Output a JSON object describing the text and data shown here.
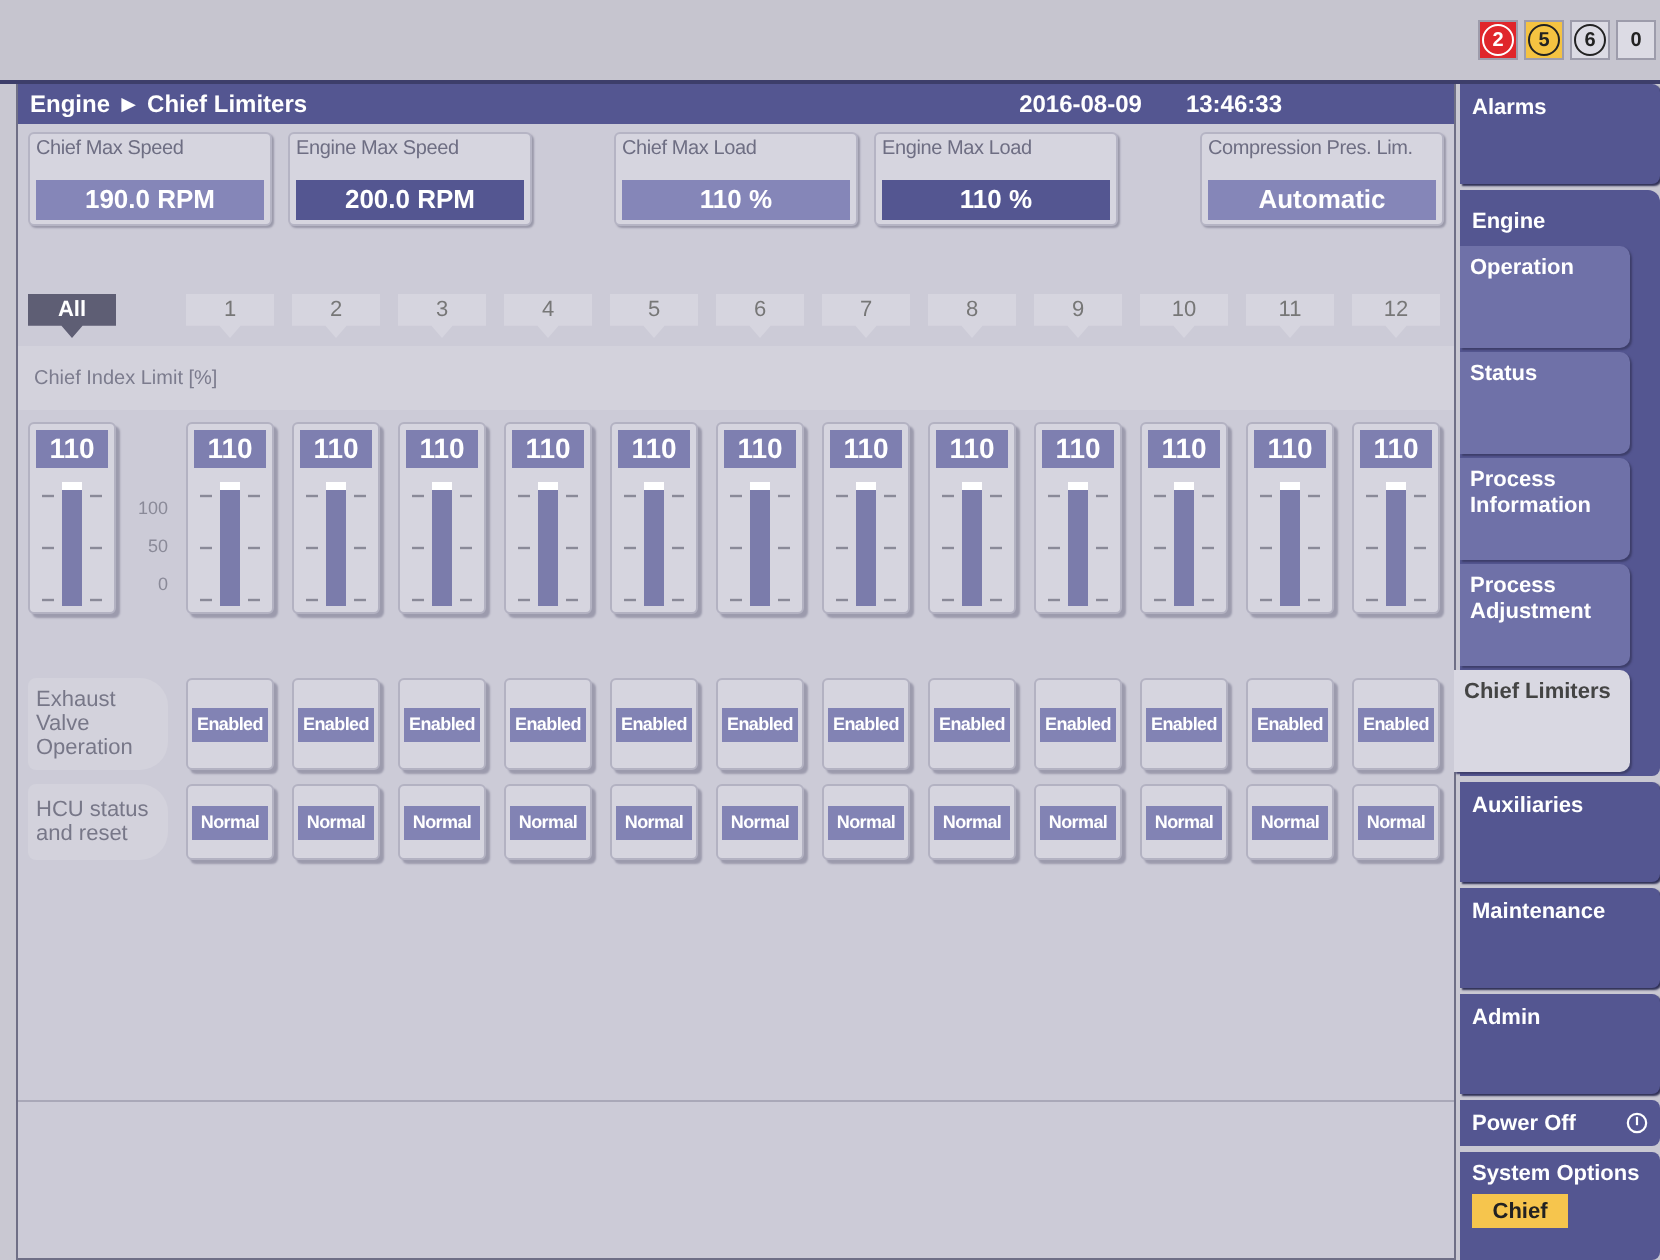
{
  "alarm_counters": [
    {
      "count": "2",
      "color": "#e0262b",
      "kind": "circled"
    },
    {
      "count": "5",
      "color": "#f5c341",
      "kind": "circled"
    },
    {
      "count": "6",
      "color": "#dcdbe4",
      "kind": "circled"
    },
    {
      "count": "0",
      "color": "#dcdbe4",
      "kind": "plain"
    }
  ],
  "header": {
    "breadcrumb": "Engine ► Chief Limiters",
    "date": "2016-08-09",
    "time": "13:46:33"
  },
  "limit_groups": [
    {
      "fields": [
        {
          "label": "Chief Max Speed",
          "value": "190.0  RPM",
          "kind": "setting"
        },
        {
          "label": "Engine Max Speed",
          "value": "200.0 RPM",
          "kind": "reference"
        }
      ]
    },
    {
      "fields": [
        {
          "label": "Chief Max Load",
          "value": "110 %",
          "kind": "setting"
        },
        {
          "label": "Engine Max Load",
          "value": "110 %",
          "kind": "reference"
        }
      ]
    },
    {
      "fields": [
        {
          "label": "Compression Pres. Lim.",
          "value": "Automatic",
          "kind": "setting"
        }
      ]
    }
  ],
  "cylinder_tabs": [
    {
      "label": "All",
      "selected": true
    },
    {
      "label": "1",
      "selected": false
    },
    {
      "label": "2",
      "selected": false
    },
    {
      "label": "3",
      "selected": false
    },
    {
      "label": "4",
      "selected": false
    },
    {
      "label": "5",
      "selected": false
    },
    {
      "label": "6",
      "selected": false
    },
    {
      "label": "7",
      "selected": false
    },
    {
      "label": "8",
      "selected": false
    },
    {
      "label": "9",
      "selected": false
    },
    {
      "label": "10",
      "selected": false
    },
    {
      "label": "11",
      "selected": false
    },
    {
      "label": "12",
      "selected": false
    }
  ],
  "index_limit": {
    "title": "Chief Index Limit [%]",
    "scale": [
      "100",
      "50",
      "0"
    ],
    "sliders": [
      {
        "value": "110",
        "level": 1
      },
      {
        "value": "110",
        "level": 1
      },
      {
        "value": "110",
        "level": 1
      },
      {
        "value": "110",
        "level": 1
      },
      {
        "value": "110",
        "level": 1
      },
      {
        "value": "110",
        "level": 1
      },
      {
        "value": "110",
        "level": 1
      },
      {
        "value": "110",
        "level": 1
      },
      {
        "value": "110",
        "level": 1
      },
      {
        "value": "110",
        "level": 1
      },
      {
        "value": "110",
        "level": 1
      },
      {
        "value": "110",
        "level": 1
      },
      {
        "value": "110",
        "level": 1
      }
    ]
  },
  "control_rows": [
    {
      "label": "Exhaust Valve Operation",
      "buttons": [
        "Enabled",
        "Enabled",
        "Enabled",
        "Enabled",
        "Enabled",
        "Enabled",
        "Enabled",
        "Enabled",
        "Enabled",
        "Enabled",
        "Enabled",
        "Enabled"
      ]
    },
    {
      "label": "HCU status and reset",
      "buttons": [
        "Normal",
        "Normal",
        "Normal",
        "Normal",
        "Normal",
        "Normal",
        "Normal",
        "Normal",
        "Normal",
        "Normal",
        "Normal",
        "Normal"
      ]
    }
  ],
  "sidebar": {
    "items": [
      {
        "kind": "tab",
        "label": "Alarms",
        "selected": false
      },
      {
        "kind": "group",
        "label": "Engine",
        "children": [
          {
            "label": "Operation",
            "selected": false
          },
          {
            "label": "Status",
            "selected": false
          },
          {
            "label": "Process Information",
            "selected": false
          },
          {
            "label": "Process Adjustment",
            "selected": false
          },
          {
            "label": "Chief Limiters",
            "selected": true
          }
        ]
      },
      {
        "kind": "tab",
        "label": "Auxiliaries",
        "selected": false
      },
      {
        "kind": "tab",
        "label": "Maintenance",
        "selected": false
      },
      {
        "kind": "tab",
        "label": "Admin",
        "selected": false
      },
      {
        "kind": "power",
        "label": "Power Off"
      },
      {
        "kind": "options",
        "label": "System Options",
        "badge": "Chief"
      }
    ]
  }
}
